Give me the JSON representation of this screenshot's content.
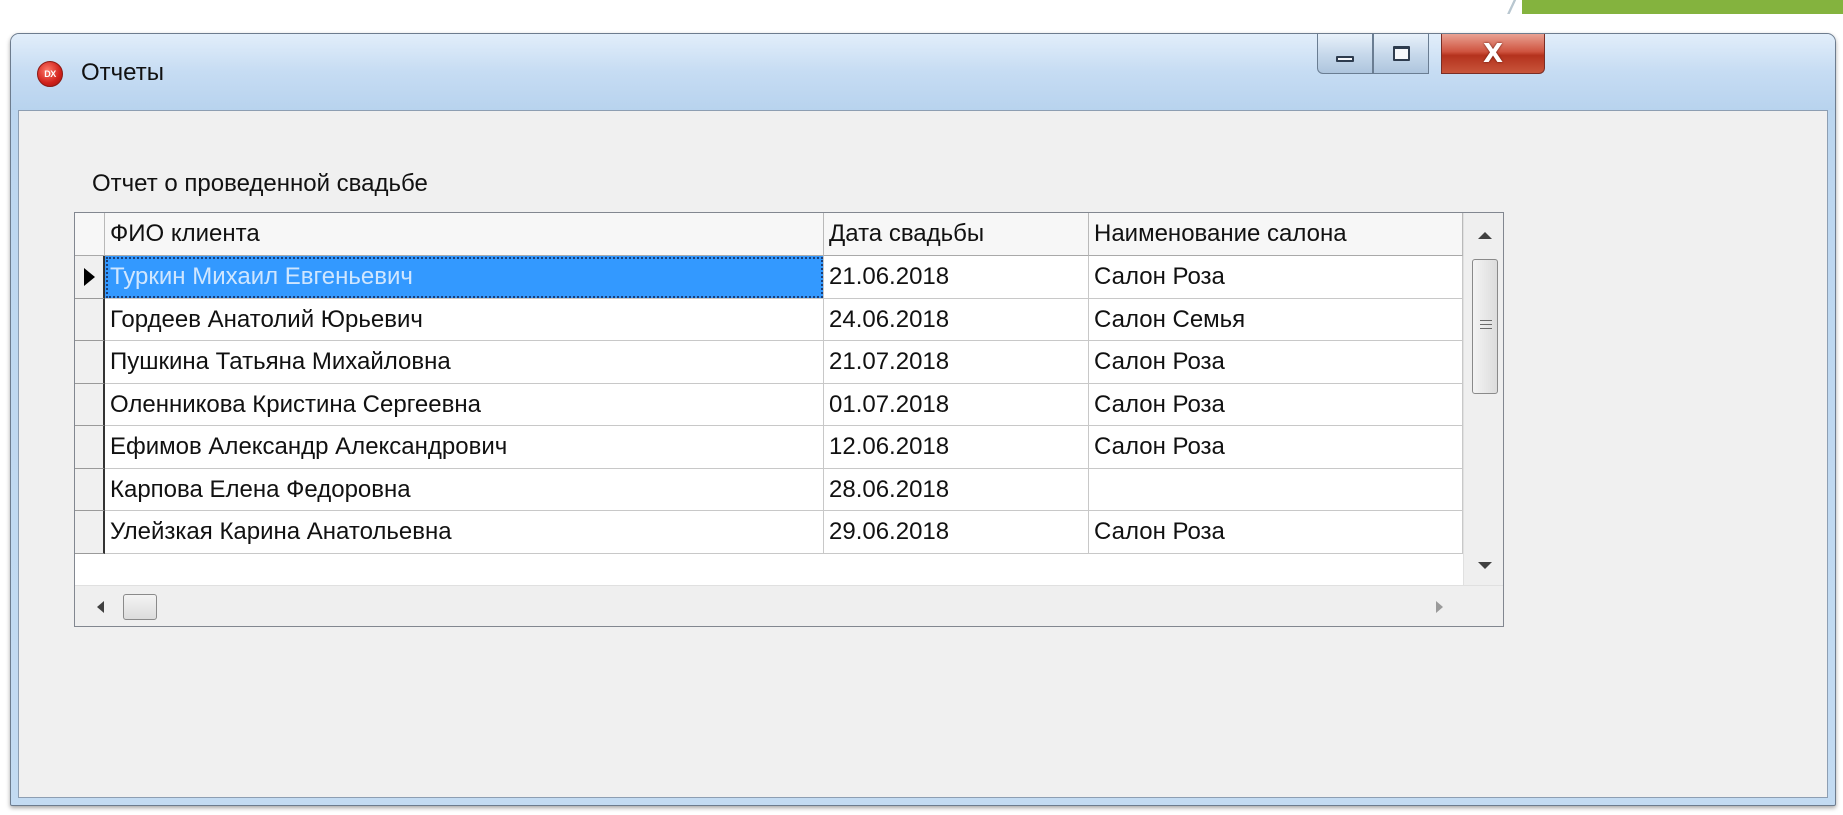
{
  "window": {
    "title": "Отчеты",
    "app_icon_text": "DX",
    "close_glyph": "X"
  },
  "report": {
    "label": "Отчет о проведенной свадьбе"
  },
  "grid": {
    "columns": [
      "ФИО клиента",
      "Дата свадьбы",
      "Наименование салона"
    ],
    "selected_row": 0,
    "rows": [
      [
        "Туркин Михаил Евгеньевич",
        "21.06.2018",
        "Салон Роза"
      ],
      [
        "Гордеев Анатолий Юрьевич",
        "24.06.2018",
        "Салон Семья"
      ],
      [
        "Пушкина Татьяна Михайловна",
        "21.07.2018",
        "Салон Роза"
      ],
      [
        "Оленникова Кристина Сергеевна",
        "01.07.2018",
        "Салон Роза"
      ],
      [
        "Ефимов Александр Александрович",
        "12.06.2018",
        "Салон Роза"
      ],
      [
        "Карпова Елена Федоровна",
        "28.06.2018",
        ""
      ],
      [
        "Улейзкая Карина Анатольевна",
        "29.06.2018",
        "Салон Роза"
      ]
    ]
  },
  "colors": {
    "selection": "#3399ff",
    "slide_accent": "#84b33e"
  },
  "icons": {
    "app": "devexpress-app-icon",
    "minimize": "minimize-icon",
    "maximize": "maximize-icon",
    "close": "close-icon",
    "row_indicator": "current-row-arrow-icon"
  }
}
